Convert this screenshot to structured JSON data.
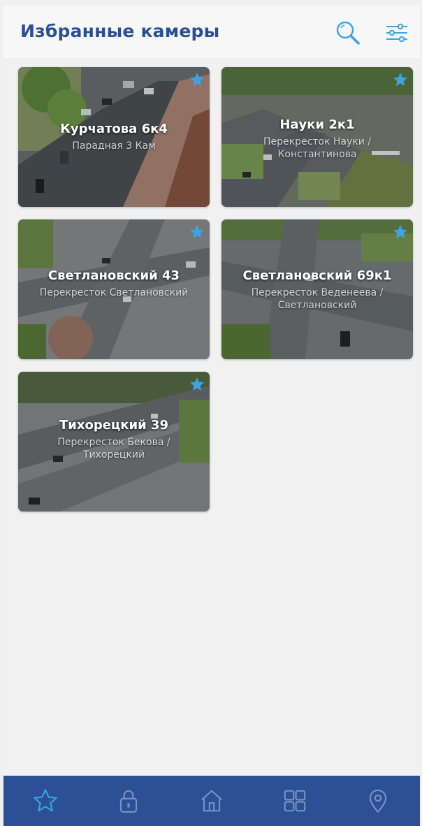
{
  "header": {
    "title": "Избранные камеры",
    "search_icon": "search-icon",
    "filter_icon": "sliders-icon"
  },
  "colors": {
    "brand": "#2c4f96",
    "accent": "#3aa5e6",
    "background": "#f1f1f1"
  },
  "cameras": [
    {
      "name": "Курчатова 6к4",
      "subtitle": "Парадная 3 Кам",
      "favorite": true
    },
    {
      "name": "Науки 2к1",
      "subtitle": "Перекресток Науки / Константинова",
      "favorite": true
    },
    {
      "name": "Светлановский 43",
      "subtitle": "Перекресток Светлановский",
      "favorite": true
    },
    {
      "name": "Светлановский 69к1",
      "subtitle": "Перекресток Веденеева / Светлановский",
      "favorite": true
    },
    {
      "name": "Тихорецкий 39",
      "subtitle": "Перекресток Бекова / Тихорецкий",
      "favorite": true
    }
  ],
  "bottom_nav": [
    {
      "icon": "star-icon",
      "active": true
    },
    {
      "icon": "lock-icon",
      "active": false
    },
    {
      "icon": "home-icon",
      "active": false
    },
    {
      "icon": "grid-icon",
      "active": false
    },
    {
      "icon": "location-icon",
      "active": false
    }
  ]
}
